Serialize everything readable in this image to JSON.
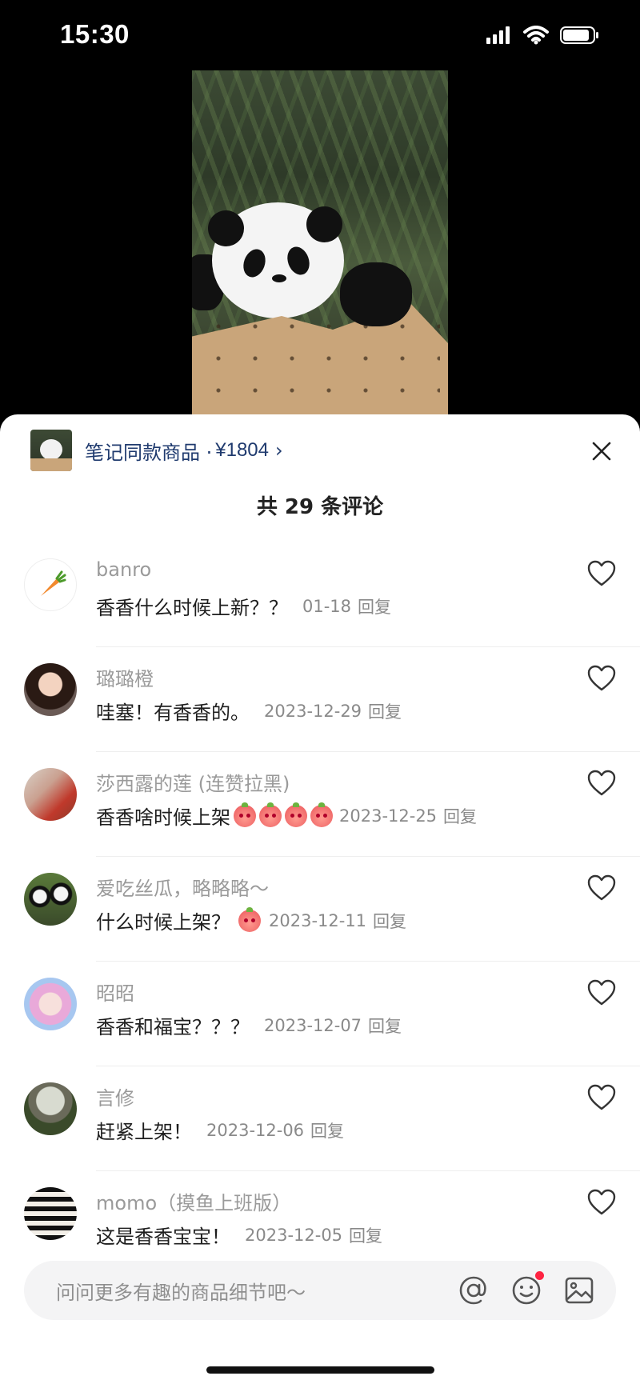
{
  "status_bar": {
    "time": "15:30"
  },
  "product": {
    "label": "笔记同款商品 · ",
    "price": "¥1804",
    "chevron": "›"
  },
  "comment_count": "共 29 条评论",
  "comments": [
    {
      "user": "banro",
      "text": "香香什么时候上新？？",
      "date": "01-18",
      "reply": "回复"
    },
    {
      "user": "璐璐橙",
      "text": "哇塞！有香香的。",
      "date": "2023-12-29",
      "reply": "回复"
    },
    {
      "user": "莎西露的莲 (连赞拉黑)",
      "text": "香香啥时候上架",
      "date": "2023-12-25",
      "reply": "回复"
    },
    {
      "user": "爱吃丝瓜，略略略～",
      "text": "什么时候上架？",
      "date": "2023-12-11",
      "reply": "回复"
    },
    {
      "user": "昭昭",
      "text": "香香和福宝？？？",
      "date": "2023-12-07",
      "reply": "回复"
    },
    {
      "user": "言修",
      "text": "赶紧上架！",
      "date": "2023-12-06",
      "reply": "回复"
    },
    {
      "user": "momo（摸鱼上班版）",
      "text": "这是香香宝宝！",
      "date": "2023-12-05",
      "reply": "回复"
    }
  ],
  "input": {
    "placeholder": "问问更多有趣的商品细节吧～"
  },
  "icons": {
    "close": "close-icon",
    "like": "heart-icon",
    "mention": "at-icon",
    "emoji": "emoji-icon",
    "image": "image-icon"
  },
  "colors": {
    "accent": "#ff2442",
    "product_link": "#1f3a6e"
  }
}
